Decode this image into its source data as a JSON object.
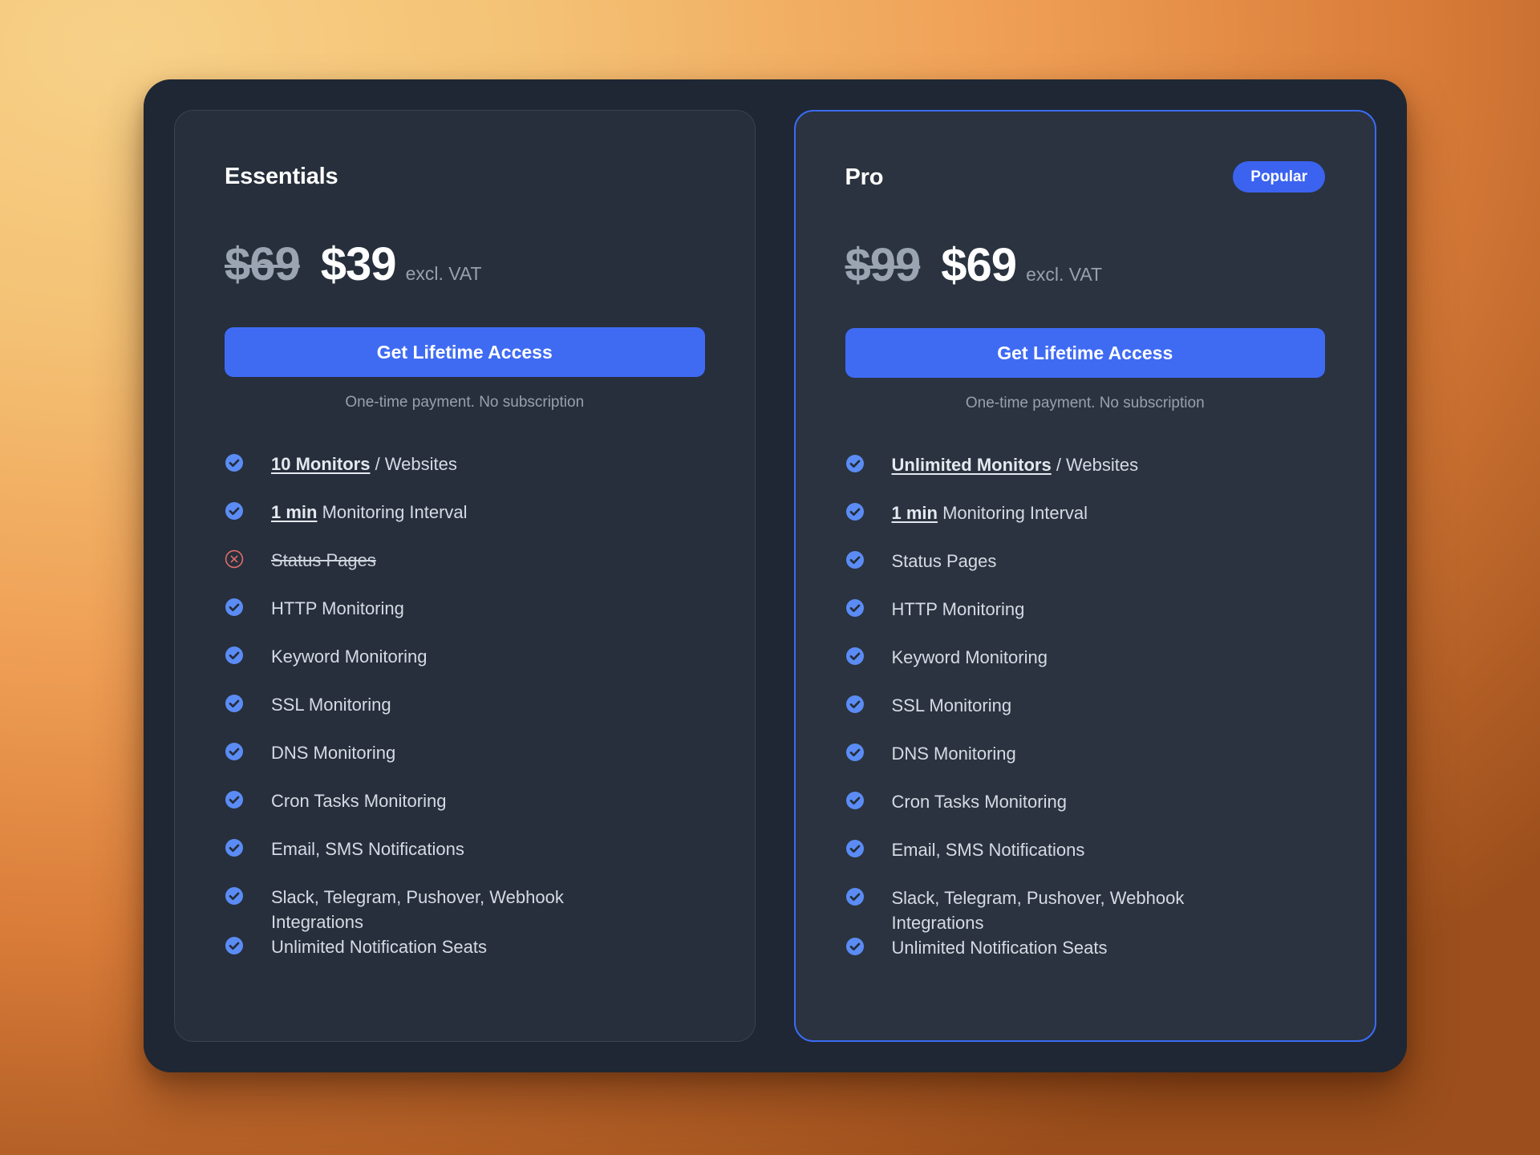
{
  "theme": {
    "accent": "#3f6bf3",
    "badge_bg": "#3b63f0",
    "card_bg": "#28313e",
    "shell_bg": "#1e2733",
    "check_color": "#5b8cf5",
    "cross_color": "#e06c6c",
    "text_primary": "#ffffff",
    "text_body": "#d5dbe4",
    "text_muted": "#97a1ae",
    "bg_gradient_from": "#f7d188",
    "bg_gradient_to": "#9c4f1c"
  },
  "plans": [
    {
      "name": "Essentials",
      "badge": null,
      "price_old": "$69",
      "price_new": "$39",
      "vat_note": "excl. VAT",
      "cta_label": "Get Lifetime Access",
      "cta_note": "One-time payment. No subscription",
      "features": [
        {
          "icon": "check-icon",
          "included": true,
          "highlight": "10 Monitors",
          "rest": " / Websites"
        },
        {
          "icon": "check-icon",
          "included": true,
          "highlight": "1 min",
          "rest": " Monitoring Interval"
        },
        {
          "icon": "cross-icon",
          "included": false,
          "highlight": null,
          "rest": "Status Pages"
        },
        {
          "icon": "check-icon",
          "included": true,
          "highlight": null,
          "rest": "HTTP Monitoring"
        },
        {
          "icon": "check-icon",
          "included": true,
          "highlight": null,
          "rest": "Keyword Monitoring"
        },
        {
          "icon": "check-icon",
          "included": true,
          "highlight": null,
          "rest": "SSL Monitoring"
        },
        {
          "icon": "check-icon",
          "included": true,
          "highlight": null,
          "rest": "DNS Monitoring"
        },
        {
          "icon": "check-icon",
          "included": true,
          "highlight": null,
          "rest": "Cron Tasks Monitoring"
        },
        {
          "icon": "check-icon",
          "included": true,
          "highlight": null,
          "rest": "Email, SMS Notifications"
        },
        {
          "icon": "check-icon",
          "included": true,
          "highlight": null,
          "rest": "Slack, Telegram, Pushover, Webhook Integrations"
        },
        {
          "icon": "check-icon",
          "included": true,
          "highlight": null,
          "rest": "Unlimited Notification Seats"
        }
      ]
    },
    {
      "name": "Pro",
      "badge": "Popular",
      "price_old": "$99",
      "price_new": "$69",
      "vat_note": "excl. VAT",
      "cta_label": "Get Lifetime Access",
      "cta_note": "One-time payment. No subscription",
      "features": [
        {
          "icon": "check-icon",
          "included": true,
          "highlight": "Unlimited Monitors",
          "rest": " / Websites"
        },
        {
          "icon": "check-icon",
          "included": true,
          "highlight": "1 min",
          "rest": " Monitoring Interval"
        },
        {
          "icon": "check-icon",
          "included": true,
          "highlight": null,
          "rest": "Status Pages"
        },
        {
          "icon": "check-icon",
          "included": true,
          "highlight": null,
          "rest": "HTTP Monitoring"
        },
        {
          "icon": "check-icon",
          "included": true,
          "highlight": null,
          "rest": "Keyword Monitoring"
        },
        {
          "icon": "check-icon",
          "included": true,
          "highlight": null,
          "rest": "SSL Monitoring"
        },
        {
          "icon": "check-icon",
          "included": true,
          "highlight": null,
          "rest": "DNS Monitoring"
        },
        {
          "icon": "check-icon",
          "included": true,
          "highlight": null,
          "rest": "Cron Tasks Monitoring"
        },
        {
          "icon": "check-icon",
          "included": true,
          "highlight": null,
          "rest": "Email, SMS Notifications"
        },
        {
          "icon": "check-icon",
          "included": true,
          "highlight": null,
          "rest": "Slack, Telegram, Pushover, Webhook Integrations"
        },
        {
          "icon": "check-icon",
          "included": true,
          "highlight": null,
          "rest": "Unlimited Notification Seats"
        }
      ]
    }
  ]
}
